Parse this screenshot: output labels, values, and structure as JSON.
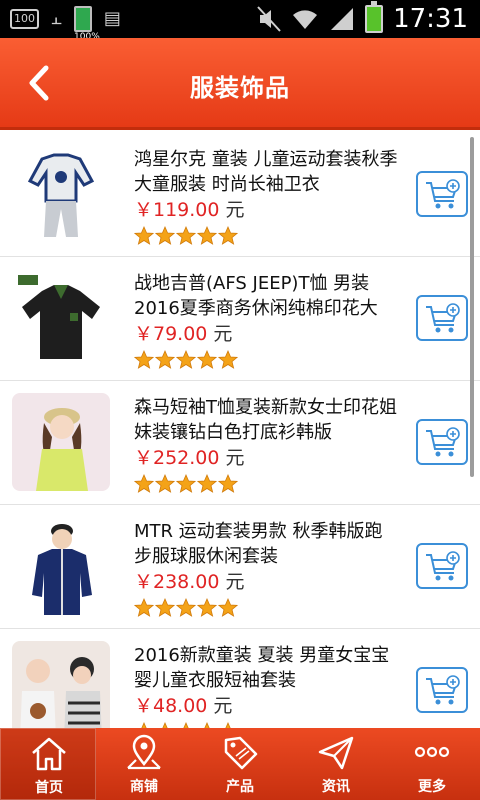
{
  "status_bar": {
    "battery_box": "100",
    "battery_level": "100%",
    "time": "17:31"
  },
  "header": {
    "title": "服装饰品",
    "back_icon": "chevron-left-icon"
  },
  "products": [
    {
      "name": "鸿星尔克 童装 儿童运动套装秋季大童服装 时尚长袖卫衣",
      "price": "￥119.00",
      "unit": "元",
      "rating": 5
    },
    {
      "name": "战地吉普(AFS JEEP)T恤 男装2016夏季商务休闲纯棉印花大",
      "price": "￥79.00",
      "unit": "元",
      "rating": 5
    },
    {
      "name": "森马短袖T恤夏装新款女士印花姐妹装镶钻白色打底衫韩版",
      "price": "￥252.00",
      "unit": "元",
      "rating": 5
    },
    {
      "name": "MTR 运动套装男款 秋季韩版跑步服球服休闲套装",
      "price": "￥238.00",
      "unit": "元",
      "rating": 5
    },
    {
      "name": "2016新款童装 夏装 男童女宝宝婴儿童衣服短袖套装",
      "price": "￥48.00",
      "unit": "元",
      "rating": 5
    }
  ],
  "bottom_nav": [
    {
      "label": "首页",
      "icon": "home-icon",
      "active": true
    },
    {
      "label": "商铺",
      "icon": "map-pin-icon",
      "active": false
    },
    {
      "label": "产品",
      "icon": "sale-tag-icon",
      "active": false
    },
    {
      "label": "资讯",
      "icon": "send-icon",
      "active": false
    },
    {
      "label": "更多",
      "icon": "more-dots-icon",
      "active": false
    }
  ],
  "colors": {
    "accent": "#e8431c",
    "price": "#e02424",
    "cart_border": "#3b8fd8",
    "star": "#f4a318"
  }
}
